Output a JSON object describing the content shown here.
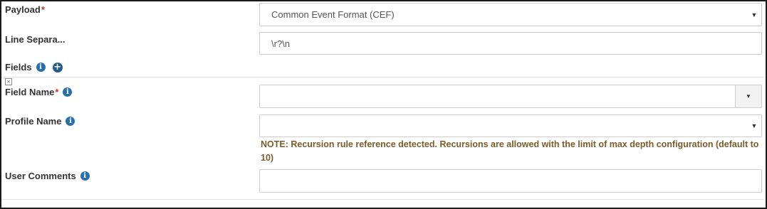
{
  "payload": {
    "label": "Payload",
    "required": "*",
    "selected": "Common Event Format (CEF)"
  },
  "line_separator": {
    "label": "Line Separa...",
    "value": "\\r?\\n"
  },
  "fields": {
    "label": "Fields",
    "info": "i",
    "add": "+"
  },
  "field_group": {
    "remove": "×",
    "field_name": {
      "label": "Field Name",
      "required": "*",
      "info": "i",
      "value": ""
    },
    "profile_name": {
      "label": "Profile Name",
      "info": "i",
      "value": ""
    },
    "note": "NOTE: Recursion rule reference detected. Recursions are allowed with the limit of max depth configuration (default to 10)",
    "user_comments": {
      "label": "User Comments",
      "info": "i",
      "value": ""
    }
  },
  "icons": {
    "info": "info-icon",
    "add": "plus-circle-icon",
    "caret": "caret-down-icon",
    "remove": "close-box-icon"
  },
  "colors": {
    "info_icon": "#2a6fa8",
    "required": "#c0392b",
    "note_text": "#7a5b2a",
    "border": "#cccccc"
  }
}
